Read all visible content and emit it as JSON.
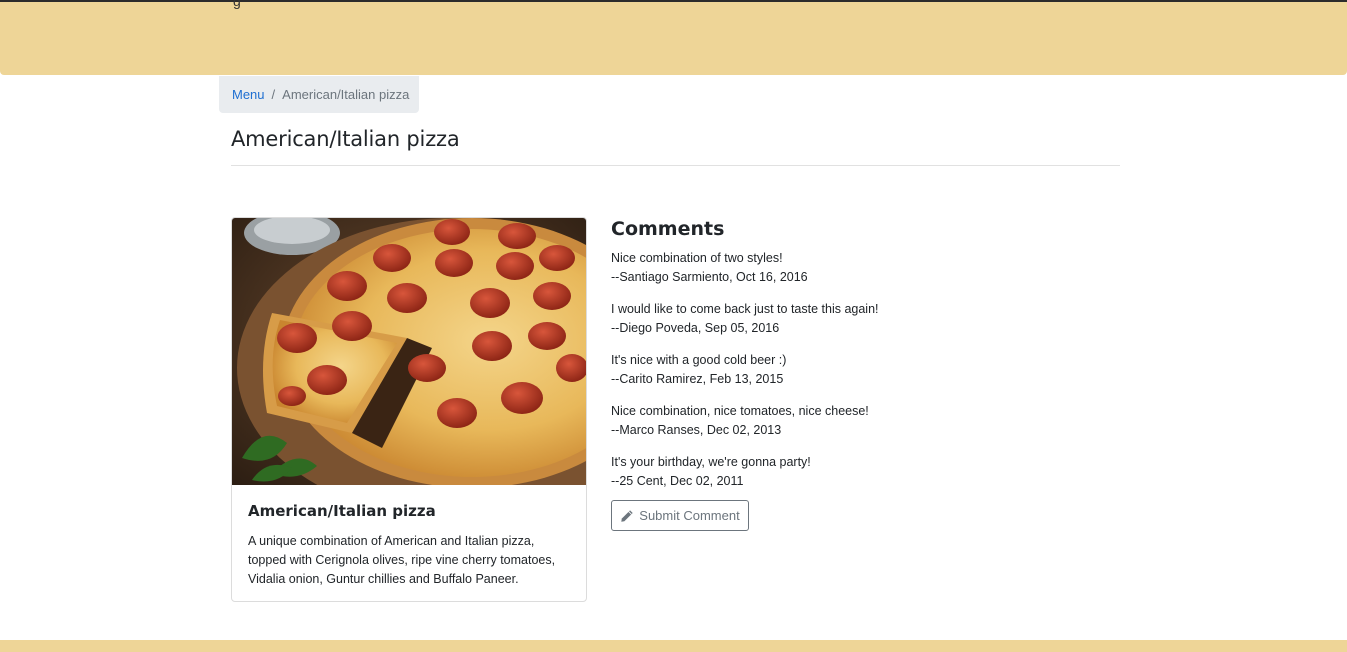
{
  "header": {
    "clipped_text": "g"
  },
  "breadcrumb": {
    "menu_label": "Menu",
    "separator": "/",
    "current": "American/Italian pizza"
  },
  "page": {
    "title": "American/Italian pizza"
  },
  "dish": {
    "image_alt": "Pepperoni pizza",
    "name": "American/Italian pizza",
    "description": "A unique combination of American and Italian pizza, topped with Cerignola olives, ripe vine cherry tomatoes, Vidalia onion, Guntur chillies and Buffalo Paneer."
  },
  "comments": {
    "heading": "Comments",
    "items": [
      {
        "text": "Nice combination of two styles!",
        "byline": "--Santiago Sarmiento, Oct 16, 2016"
      },
      {
        "text": "I would like to come back just to taste this again!",
        "byline": "--Diego Poveda, Sep 05, 2016"
      },
      {
        "text": "It's nice with a good cold beer :)",
        "byline": "--Carito Ramirez, Feb 13, 2015"
      },
      {
        "text": "Nice combination, nice tomatoes, nice cheese!",
        "byline": "--Marco Ranses, Dec 02, 2013"
      },
      {
        "text": "It's your birthday, we're gonna party!",
        "byline": "--25 Cent, Dec 02, 2011"
      }
    ]
  },
  "actions": {
    "submit_label": "Submit Comment",
    "submit_icon": "pencil-icon"
  },
  "colors": {
    "banner": "#eed597",
    "link": "#1f6fd1",
    "breadcrumb_bg": "#e9ecef"
  }
}
